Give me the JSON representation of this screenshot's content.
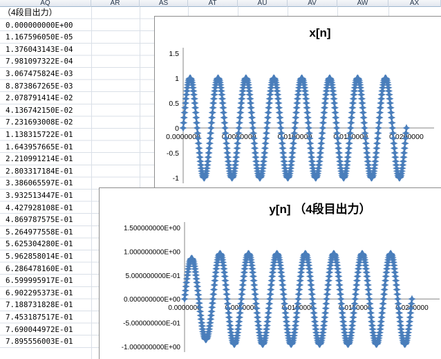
{
  "spreadsheet": {
    "column_headers": [
      "AQ",
      "AR",
      "AS",
      "AT",
      "AU",
      "AV",
      "AW",
      "AX"
    ],
    "column_aq_header_cell": "（4段目出力）",
    "column_aq_values": [
      "0.000000000E+00",
      "1.167596050E-05",
      "1.376043143E-04",
      "7.981097322E-04",
      "3.067475824E-03",
      "8.873867265E-03",
      "2.078791414E-02",
      "4.136742150E-02",
      "7.231693008E-02",
      "1.138315722E-01",
      "1.643957665E-01",
      "2.210991214E-01",
      "2.803317184E-01",
      "3.386065597E-01",
      "3.932513447E-01",
      "4.427928108E-01",
      "4.869787575E-01",
      "5.264977558E-01",
      "5.625304280E-01",
      "5.962858014E-01",
      "6.286478160E-01",
      "6.599995917E-01",
      "6.902295373E-01",
      "7.188731828E-01",
      "7.453187517E-01",
      "7.690044972E-01",
      "7.895556003E-01"
    ]
  },
  "chart_data": [
    {
      "type": "scatter",
      "title": "x[n]",
      "xlabel": "",
      "ylabel": "",
      "xlim": [
        0,
        0.02
      ],
      "ylim": [
        -1,
        1.5
      ],
      "x_ticks": [
        "0.0000000",
        "0.0050000",
        "0.0100000",
        "0.0150000",
        "0.0200000"
      ],
      "y_ticks": [
        "-1",
        "-0.5",
        "0",
        "0.5",
        "1",
        "1.5"
      ],
      "series": [
        {
          "signal": "sine",
          "amplitude": 1.0,
          "frequency_hz": 400,
          "x_start": 0,
          "x_end": 0.02,
          "samples": 480,
          "marker": "star",
          "color": "#4a7ebb"
        }
      ]
    },
    {
      "type": "scatter",
      "title": "y[n] （4段目出力）",
      "xlabel": "",
      "ylabel": "",
      "xlim": [
        0,
        0.02
      ],
      "ylim": [
        -1.0,
        1.5
      ],
      "x_ticks": [
        "0.0000000",
        "0.0050000",
        "0.0100000",
        "0.0150000",
        "0.0200000"
      ],
      "y_ticks": [
        "-1.000000000E+00",
        "-5.000000000E-01",
        "0.000000000E+00",
        "5.000000000E-01",
        "1.000000000E+00",
        "1.500000000E+00"
      ],
      "series": [
        {
          "signal": "sine",
          "amplitude": 0.95,
          "frequency_hz": 400,
          "x_start": 0,
          "x_end": 0.02,
          "samples": 480,
          "marker": "star",
          "color": "#4a7ebb",
          "first_peak": 0.85
        }
      ]
    }
  ]
}
